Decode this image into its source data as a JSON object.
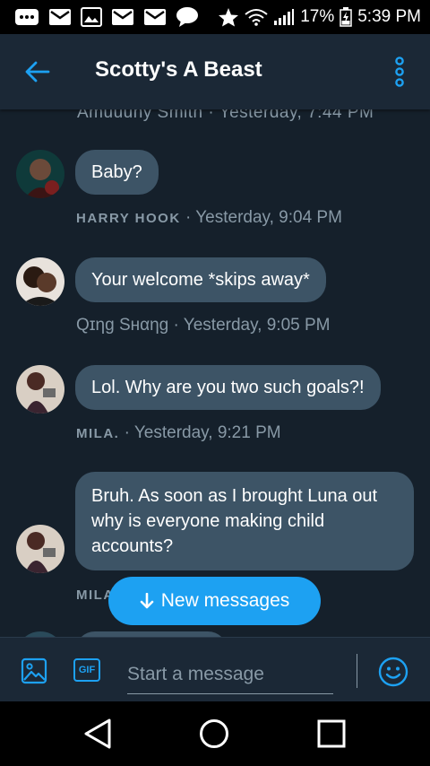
{
  "status_bar": {
    "battery": "17%",
    "time": "5:39 PM"
  },
  "header": {
    "title": "Scotty's A Beast"
  },
  "conversation": {
    "partial_meta": "Amuuuhy Smith · Yesterday, 7:44 PM",
    "messages": [
      {
        "text": "Baby?",
        "name": "HARRY HOOK",
        "time": " · Yesterday, 9:04 PM"
      },
      {
        "text": "Your welcome *skips away*",
        "name": "Qɪηg Sнαηg",
        "time": " · Yesterday, 9:05 PM"
      },
      {
        "text": "Lol.  Why are you two such goals?!",
        "name": "MILA.",
        "time": " · Yesterday, 9:21 PM"
      },
      {
        "text": "Bruh. As soon as I brought Luna out why is everyone making child accounts?",
        "name": "MILA",
        "time": ""
      }
    ]
  },
  "new_messages_label": "New messages",
  "composer": {
    "gif_label": "GIF",
    "placeholder": "Start a message"
  },
  "colors": {
    "background": "#15202b",
    "header": "#1b2836",
    "bubble": "#3d5466",
    "accent": "#1da1f2",
    "meta": "#8899a6"
  },
  "icons": {
    "status": [
      "notification-icon",
      "mail-icon",
      "image-icon",
      "mail-icon",
      "mail-icon",
      "chat-bubble-icon",
      "star-icon",
      "wifi-icon",
      "signal-icon",
      "battery-icon"
    ],
    "header": [
      "back-arrow-icon",
      "more-vertical-icon"
    ],
    "composer": [
      "image-icon",
      "gif-icon",
      "emoji-icon"
    ],
    "nav": [
      "nav-back-icon",
      "nav-home-icon",
      "nav-recents-icon"
    ]
  }
}
